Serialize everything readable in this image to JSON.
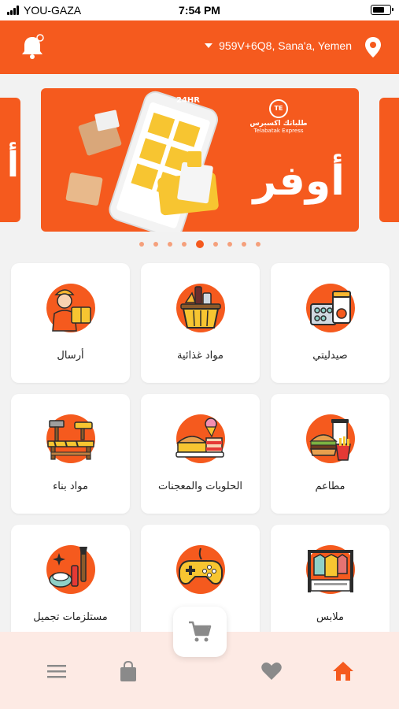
{
  "status_bar": {
    "carrier": "YOU-GAZA",
    "time": "7:54 PM"
  },
  "header": {
    "location": "959V+6Q8, Sana'a, Yemen"
  },
  "banner": {
    "promo_text": "أوفر",
    "brand_ar": "طلباتك اكسبرس",
    "brand_en": "Telabatak Express",
    "logo_text": "TE",
    "hours_badge": "24HR",
    "side_left_text": "أ",
    "slide_count": 9,
    "active_slide": 5
  },
  "categories": [
    {
      "label": "صيدليتي",
      "icon": "pharmacy-icon"
    },
    {
      "label": "مواد غذائية",
      "icon": "grocery-basket-icon"
    },
    {
      "label": "أرسال",
      "icon": "delivery-person-icon"
    },
    {
      "label": "مطاعم",
      "icon": "fast-food-icon"
    },
    {
      "label": "الحلويات والمعجنات",
      "icon": "sweets-icon"
    },
    {
      "label": "مواد بناء",
      "icon": "construction-tools-icon"
    },
    {
      "label": "ملابس",
      "icon": "clothes-rack-icon"
    },
    {
      "label": "",
      "icon": "gamepad-icon"
    },
    {
      "label": "مستلزمات تجميل",
      "icon": "cosmetics-icon"
    }
  ],
  "colors": {
    "accent": "#f55a1e",
    "nav_bg": "#fdeae4",
    "nav_inactive": "#8a8a8a"
  },
  "nav": [
    {
      "name": "menu-icon"
    },
    {
      "name": "orders-bag-icon"
    },
    {
      "name": "favorites-heart-icon"
    },
    {
      "name": "home-icon"
    }
  ]
}
